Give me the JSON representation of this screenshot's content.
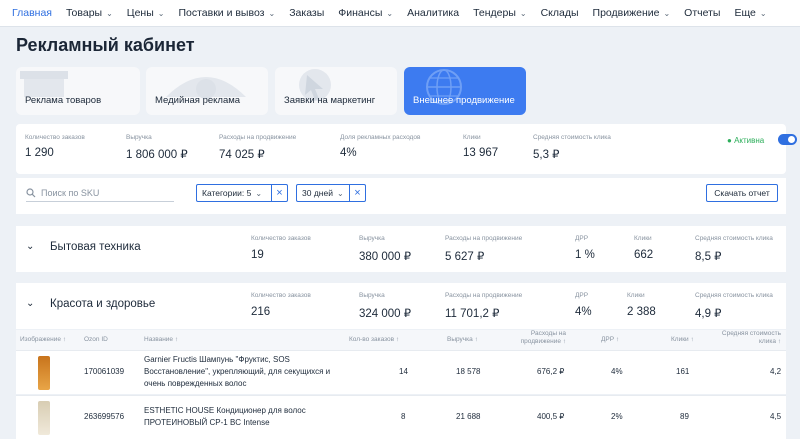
{
  "nav": [
    {
      "label": "Главная",
      "active": true,
      "dropdown": false
    },
    {
      "label": "Товары",
      "dropdown": true
    },
    {
      "label": "Цены",
      "dropdown": true
    },
    {
      "label": "Поставки и вывоз",
      "dropdown": true
    },
    {
      "label": "Заказы",
      "dropdown": false
    },
    {
      "label": "Финансы",
      "dropdown": true
    },
    {
      "label": "Аналитика",
      "dropdown": false
    },
    {
      "label": "Тендеры",
      "dropdown": true
    },
    {
      "label": "Склады",
      "dropdown": false
    },
    {
      "label": "Продвижение",
      "dropdown": true
    },
    {
      "label": "Отчеты",
      "dropdown": false
    },
    {
      "label": "Еще",
      "dropdown": true
    }
  ],
  "page_title": "Рекламный кабинет",
  "ad_types": [
    {
      "label": "Реклама товаров",
      "icon": "box-icon"
    },
    {
      "label": "Медийная реклама",
      "icon": "eye-icon"
    },
    {
      "label": "Заявки на маркетинг",
      "icon": "cursor-icon"
    },
    {
      "label": "Внешнее продвижение",
      "icon": "globe-icon",
      "selected": true
    }
  ],
  "summary": {
    "stats": [
      {
        "label": "Количество заказов",
        "value": "1 290"
      },
      {
        "label": "Выручка",
        "value": "1 806 000 ₽"
      },
      {
        "label": "Расходы на продвижение",
        "value": "74 025 ₽"
      },
      {
        "label": "Доля рекламных расходов",
        "value": "4%"
      },
      {
        "label": "Клики",
        "value": "13 967"
      },
      {
        "label": "Средняя стоимость клика",
        "value": "5,3 ₽"
      }
    ],
    "status_label": "Активна",
    "status_on": true
  },
  "filters": {
    "search_placeholder": "Поиск по SKU",
    "category_chip": "Категории: 5",
    "period_chip": "30 дней",
    "download_label": "Скачать отчет"
  },
  "categories": [
    {
      "name": "Бытовая техника",
      "stats": [
        {
          "label": "Количество заказов",
          "value": "19"
        },
        {
          "label": "Выручка",
          "value": "380 000 ₽"
        },
        {
          "label": "Расходы на продвижение",
          "value": "5 627 ₽"
        },
        {
          "label": "ДРР",
          "value": "1 %"
        },
        {
          "label": "Клики",
          "value": "662"
        },
        {
          "label": "Средняя стоимость клика",
          "value": "8,5 ₽"
        }
      ]
    },
    {
      "name": "Красота и здоровье",
      "stats": [
        {
          "label": "Количество заказов",
          "value": "216"
        },
        {
          "label": "Выручка",
          "value": "324 000 ₽"
        },
        {
          "label": "Расходы на продвижение",
          "value": "11 701,2 ₽"
        },
        {
          "label": "ДРР",
          "value": "4%"
        },
        {
          "label": "Клики",
          "value": "2 388"
        },
        {
          "label": "Средняя стоимость клика",
          "value": "4,9 ₽"
        }
      ]
    }
  ],
  "table": {
    "headers": [
      "Изображение ↑",
      "Ozon ID",
      "Название ↑",
      "Кол-во заказов ↑",
      "Выручка ↑",
      "Расходы на продвижение ↑",
      "ДРР ↑",
      "Клики ↑",
      "Средняя стоимость клика ↑"
    ],
    "rows": [
      {
        "ozon_id": "170061039",
        "name_lines": [
          "Garnier Fructis Шампунь \"Фруктис, SOS",
          "Восстановление\", укрепляющий, для секущихся и",
          "очень поврежденных волос"
        ],
        "orders": "14",
        "revenue": "18 578",
        "spend": "676,2 ₽",
        "drr": "4%",
        "clicks": "161",
        "cpc": "4,2",
        "image_color": "#d9892a"
      },
      {
        "ozon_id": "263699576",
        "name_lines": [
          "ESTHETIC HOUSE Кондиционер для волос",
          "ПРОТЕИНОВЫЙ CP-1 BC Intense"
        ],
        "orders": "8",
        "revenue": "21 688",
        "spend": "400,5 ₽",
        "drr": "2%",
        "clicks": "89",
        "cpc": "4,5",
        "image_color": "#e8e0cf"
      }
    ]
  },
  "colors": {
    "accent": "#2f6fe0",
    "active_green": "#2cae5a",
    "background": "#edf1f6"
  }
}
